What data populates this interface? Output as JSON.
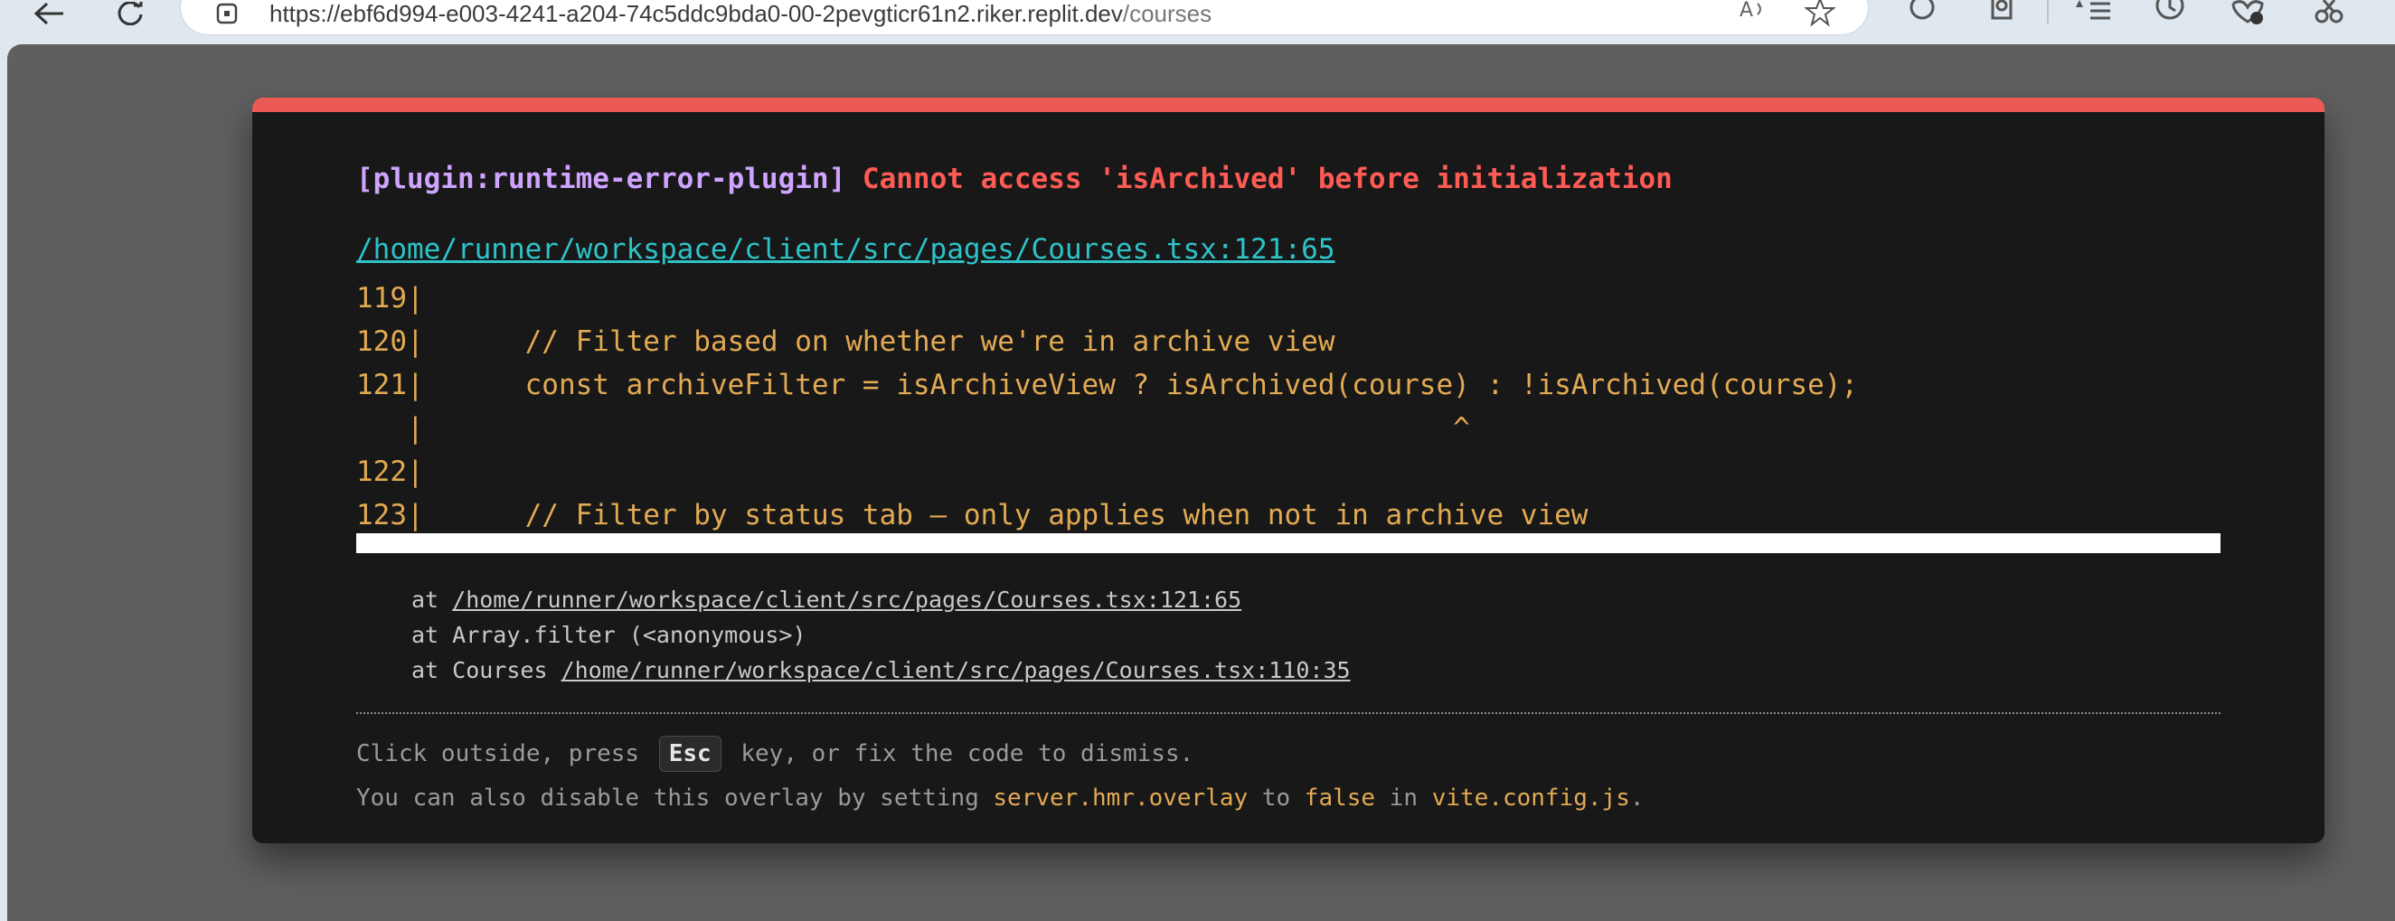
{
  "browser": {
    "url_base": "https://ebf6d994-e003-4241-a204-74c5ddc9bda0-00-2pevgticr61n2.riker.replit.dev",
    "url_path": "/courses",
    "icons": [
      "back-arrow-icon",
      "refresh-icon",
      "site-info-icon",
      "read-aloud-icon",
      "favorite-star-icon",
      "grammarly-extension-icon",
      "extensions-puzzle-icon",
      "favorites-list-icon",
      "history-icon",
      "browser-essentials-icon",
      "screenshot-icon"
    ]
  },
  "overlay": {
    "plugin": "[plugin:runtime-error-plugin]",
    "message": "Cannot access 'isArchived' before initialization",
    "file": "/home/runner/workspace/client/src/pages/Courses.tsx:121:65",
    "frame_lines": [
      "119|",
      "120|      // Filter based on whether we're in archive view",
      "121|      const archiveFilter = isArchiveView ? isArchived(course) : !isArchived(course);",
      "   |                                                             ^",
      "122|",
      "123|      // Filter by status tab – only applies when not in archive view"
    ],
    "stack": [
      {
        "prefix": "at ",
        "link": "/home/runner/workspace/client/src/pages/Courses.tsx:121:65",
        "text": ""
      },
      {
        "prefix": "at Array.filter (<anonymous>)",
        "link": "",
        "text": ""
      },
      {
        "prefix": "at Courses ",
        "link": "/home/runner/workspace/client/src/pages/Courses.tsx:110:35",
        "text": ""
      }
    ],
    "tip1_a": "Click outside, press",
    "tip1_key": "Esc",
    "tip1_b": "key, or fix the code to dismiss.",
    "tip2_a": "You can also disable this overlay by setting",
    "tip2_code1": "server.hmr.overlay",
    "tip2_b": "to",
    "tip2_code2": "false",
    "tip2_c": "in",
    "tip2_code3": "vite.config.js",
    "tip2_d": "."
  },
  "colors": {
    "accent_bar": "#ec5a56",
    "plugin": "#cfa4ff",
    "error": "#ff5b55",
    "file_link": "#2ec3c9",
    "code": "#e2aa53"
  }
}
